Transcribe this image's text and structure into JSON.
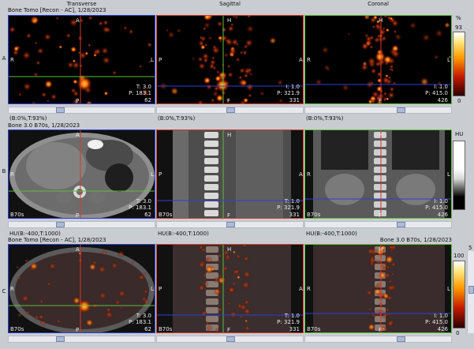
{
  "headers": {
    "transverse": "Transverse",
    "sagittal": "Sagittal",
    "coronal": "Coronal"
  },
  "rows": {
    "a": "A",
    "b": "B",
    "c": "C"
  },
  "row_a": {
    "info": "Bone Tomo [Recon - AC], 1/28/2023",
    "trans": {
      "ant": "A",
      "post": "P",
      "right": "R",
      "left": "L",
      "t": "T: 3.0",
      "p": "P: 183.1",
      "n": "62"
    },
    "sag": {
      "top": "H",
      "bottom": "F",
      "left": "P",
      "right": "A",
      "t": "I: 1.0",
      "p": "P: 321.9",
      "n": "331"
    },
    "cor": {
      "top": "H",
      "bottom": "F",
      "left": "R",
      "right": "L",
      "t": "I: 1.0",
      "p": "P: 415.0",
      "n": "426"
    },
    "win": [
      "(B:0%,T:93%)",
      "(B:0%,T:93%)",
      "(B:0%,T:93%)"
    ],
    "scale": {
      "unit": "%",
      "top": "93",
      "bottom": "0"
    }
  },
  "row_b": {
    "info": "Bone  3.0  B70s, 1/28/2023",
    "trans": {
      "ant": "A",
      "post": "P",
      "right": "R",
      "left": "L",
      "t": "T: 3.0",
      "p": "P: 183.1",
      "n": "62",
      "k": "B70s"
    },
    "sag": {
      "top": "H",
      "bottom": "F",
      "left": "P",
      "right": "A",
      "t": "T: 1.0",
      "p": "P: 321.9",
      "n": "331",
      "k": "B70s"
    },
    "cor": {
      "top": "H",
      "bottom": "F",
      "left": "R",
      "right": "L",
      "t": "I: 1.0",
      "p": "P: 415.0",
      "n": "426",
      "k": "B70s"
    },
    "win": [
      "HU(B:-400,T:1000)",
      "HU(B:-400,T:1000)",
      "HU(B:-400,T:1000)"
    ],
    "scale": {
      "unit": "HU"
    }
  },
  "row_c": {
    "info_left": "Bone Tomo [Recon - AC], 1/28/2023",
    "info_right": "Bone  3.0  B70s, 1/28/2023",
    "trans": {
      "ant": "A",
      "post": "P",
      "right": "R",
      "left": "L",
      "t": "T: 3.0",
      "p": "P: 183.1",
      "n": "62",
      "k": "B70s"
    },
    "sag": {
      "top": "H",
      "bottom": "F",
      "left": "P",
      "right": "A",
      "t": "T: 1.0",
      "p": "P: 321.9",
      "n": "331",
      "k": "B70s"
    },
    "cor": {
      "top": "H",
      "bottom": "F",
      "left": "R",
      "right": "L",
      "t": "I: 1.0",
      "p": "P: 415.0",
      "n": "426",
      "k": "B70s"
    },
    "scale": {
      "top": "100",
      "bottom": "0",
      "extra": "5"
    }
  },
  "colors": {
    "red": "#d23a2a",
    "green": "#5bbf3a",
    "blue": "#2d3fd6",
    "hot": "#ffb000"
  }
}
